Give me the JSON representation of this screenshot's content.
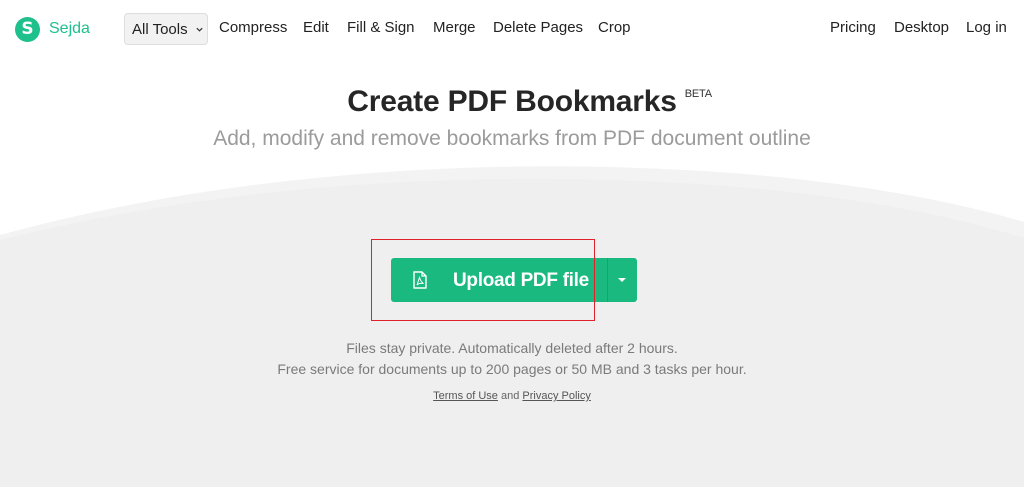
{
  "brand": {
    "logo_letter": "S",
    "name": "Sejda",
    "accent_color": "#1ec08c"
  },
  "nav": {
    "all_tools": "All Tools",
    "items": [
      "Compress",
      "Edit",
      "Fill & Sign",
      "Merge",
      "Delete Pages",
      "Crop"
    ],
    "right_items": [
      "Pricing",
      "Desktop",
      "Log in"
    ]
  },
  "hero": {
    "title": "Create PDF Bookmarks",
    "badge": "BETA",
    "subtitle": "Add, modify and remove bookmarks from PDF document outline"
  },
  "upload": {
    "label": "Upload PDF file",
    "icon": "pdf-file-icon",
    "dropdown_icon": "caret-down-icon",
    "button_color": "#19b97f"
  },
  "notes": {
    "line1": "Files stay private. Automatically deleted after 2 hours.",
    "line2": "Free service for documents up to 200 pages or 50 MB and 3 tasks per hour."
  },
  "legal": {
    "terms": "Terms of Use",
    "and": "and",
    "privacy": "Privacy Policy"
  },
  "annotation": {
    "highlight_color": "#e0202a"
  }
}
